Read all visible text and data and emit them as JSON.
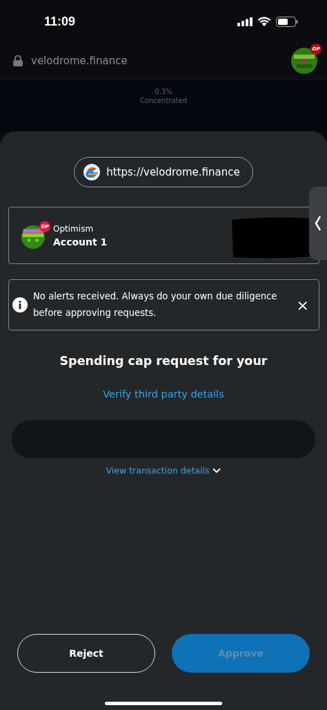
{
  "status_bar": {
    "time": "11:09"
  },
  "browser_bar": {
    "domain": "velodrome.finance",
    "network_badge": "OP"
  },
  "background_page": {
    "fee": "0.3%",
    "pool_type": "Concentrated"
  },
  "sheet": {
    "origin": "https://velodrome.finance",
    "account": {
      "network": "Optimism",
      "name": "Account 1",
      "network_badge": "OP"
    },
    "alert": {
      "message": "No alerts received. Always do your own due diligence before approving requests.",
      "dismiss": "×"
    },
    "title": "Spending cap request for your",
    "verify_link": "Verify third party details",
    "details_link": "View transaction details",
    "buttons": [
      {
        "label": "Reject",
        "kind": "secondary",
        "disabled": false
      },
      {
        "label": "Approve",
        "kind": "primary",
        "disabled": true
      }
    ]
  }
}
